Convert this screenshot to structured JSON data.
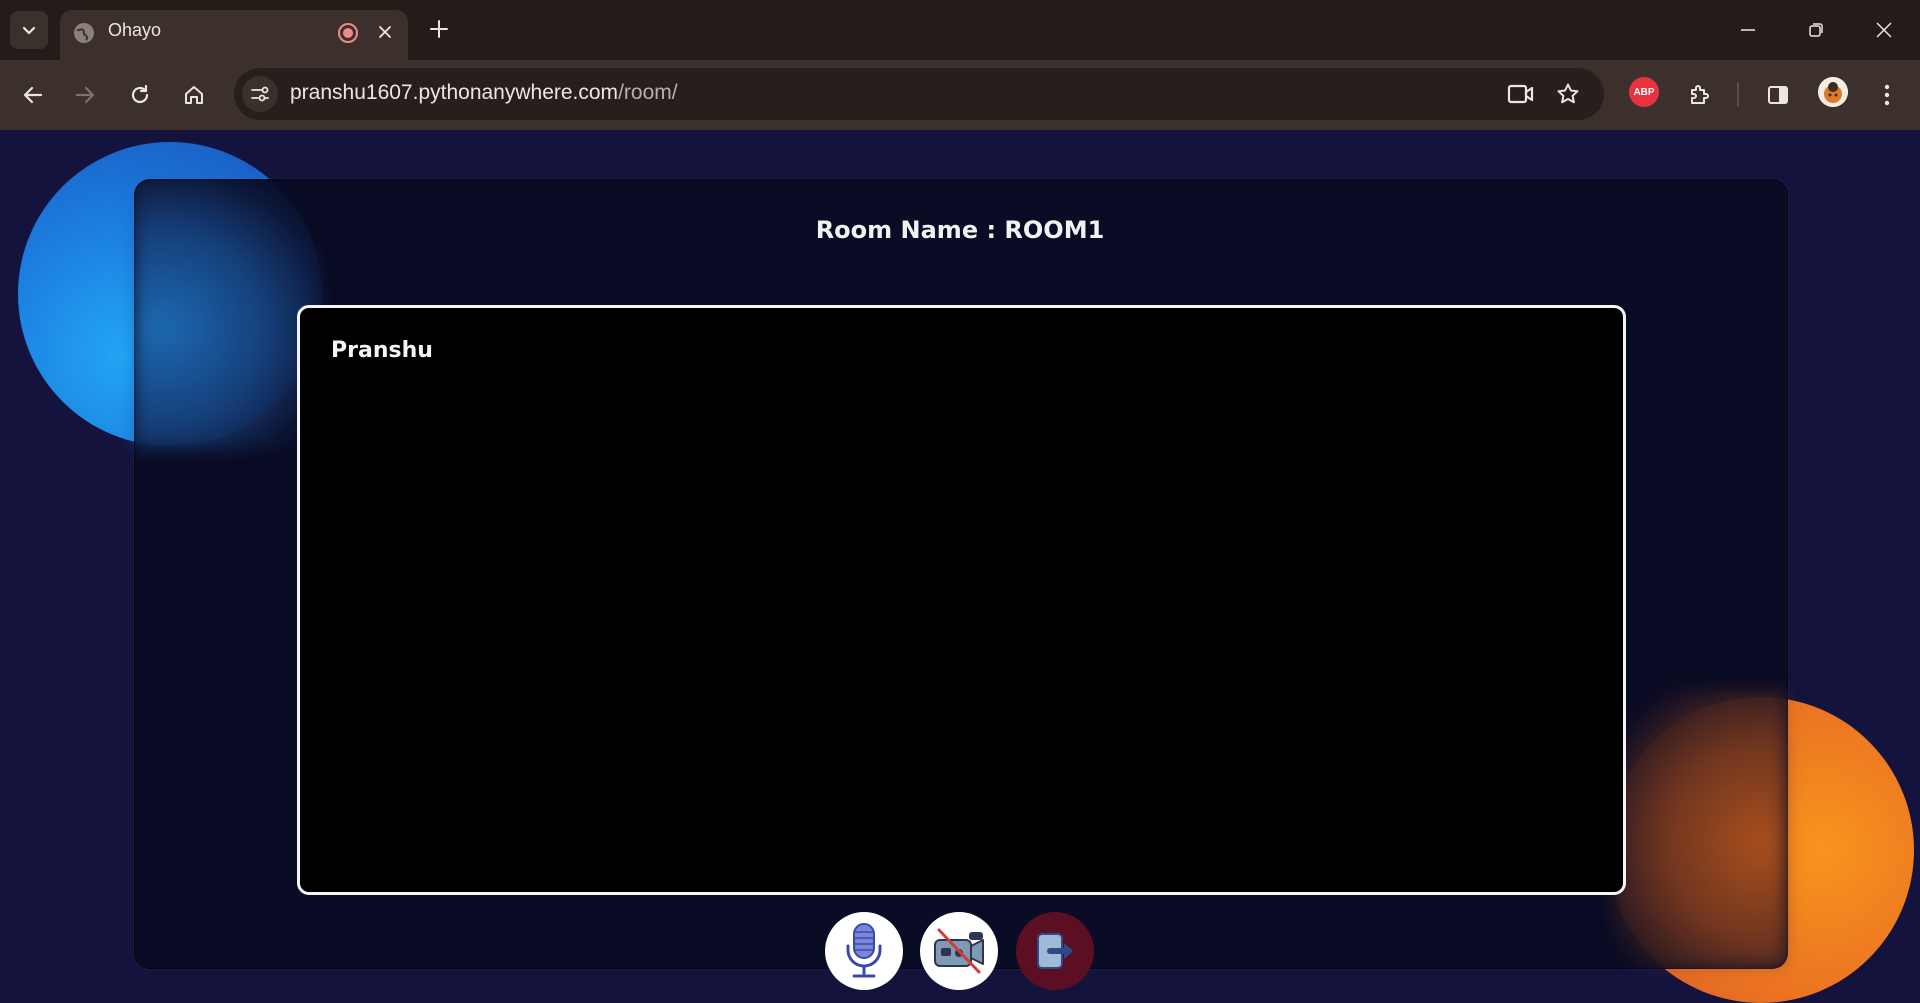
{
  "browser": {
    "tab_title": "Ohayo",
    "url_host": "pranshu1607.pythonanywhere.com",
    "url_path": "/room/",
    "extension_badge": "ABP",
    "icons": [
      "tab-search-icon",
      "globe-icon",
      "recording-icon",
      "close-icon",
      "plus-icon",
      "minimize-icon",
      "restore-icon",
      "close-window-icon",
      "back-icon",
      "forward-icon",
      "reload-icon",
      "home-icon",
      "site-settings-icon",
      "camera-icon",
      "star-icon",
      "extensions-icon",
      "side-panel-icon",
      "avatar",
      "kebab-menu-icon"
    ]
  },
  "room": {
    "label": "Room Name : ",
    "name": "ROOM1"
  },
  "video": {
    "participant_name": "Pranshu"
  },
  "controls": {
    "icons": [
      "microphone-icon",
      "camera-off-icon",
      "leave-icon"
    ]
  },
  "colors": {
    "page_background": "#14133d",
    "panel_background": "#0a0b22",
    "orb_blue": "#1c7ee0",
    "orb_orange": "#ec7422",
    "leave_button": "#5c0f22"
  }
}
